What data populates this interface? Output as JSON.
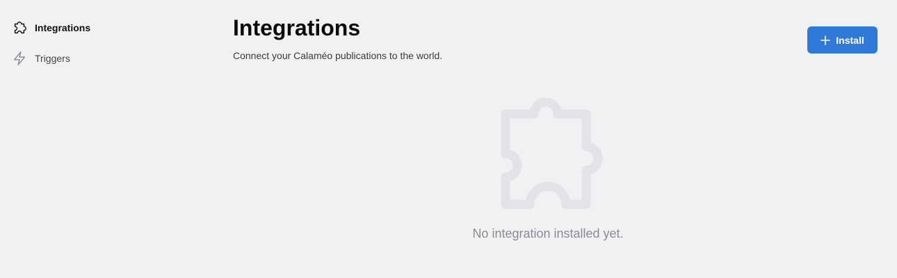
{
  "sidebar": {
    "items": [
      {
        "label": "Integrations",
        "icon": "puzzle-icon",
        "active": true
      },
      {
        "label": "Triggers",
        "icon": "lightning-icon",
        "active": false
      }
    ]
  },
  "header": {
    "title": "Integrations",
    "subtitle": "Connect your Calaméo publications to the world.",
    "install_label": "Install"
  },
  "empty_state": {
    "icon": "puzzle-icon",
    "message": "No integration installed yet."
  },
  "colors": {
    "background": "#f0f1f3",
    "accent": "#3079d6",
    "empty_icon": "#e2e3e6",
    "muted_text": "#8a8c90"
  }
}
